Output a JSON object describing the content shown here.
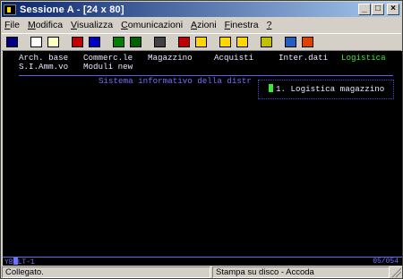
{
  "window": {
    "title": "Sessione A - [24 x 80]"
  },
  "menu": [
    {
      "mnemonic": "F",
      "rest": "ile"
    },
    {
      "mnemonic": "M",
      "rest": "odifica"
    },
    {
      "mnemonic": "V",
      "rest": "isualizza"
    },
    {
      "mnemonic": "C",
      "rest": "omunicazioni"
    },
    {
      "mnemonic": "A",
      "rest": "zioni"
    },
    {
      "mnemonic": "F",
      "rest": "inestra"
    },
    {
      "mnemonic": "?",
      "rest": ""
    }
  ],
  "toolbar": [
    {
      "icon": "print-screen-icon",
      "color": "#000080"
    },
    {
      "icon": "copy-icon",
      "color": "#ffffff"
    },
    {
      "icon": "paste-icon",
      "color": "#ffffc0"
    },
    {
      "icon": "send-file-icon",
      "color": "#c00000"
    },
    {
      "icon": "receive-file-icon",
      "color": "#0000c0"
    },
    {
      "icon": "display-icon",
      "color": "#008000"
    },
    {
      "icon": "display-session-icon",
      "color": "#006000"
    },
    {
      "icon": "record-macro-icon",
      "color": "#404040"
    },
    {
      "icon": "play-macro-icon",
      "color": "#c00000"
    },
    {
      "icon": "stop-macro-icon",
      "color": "#ffd700"
    },
    {
      "icon": "macro-run-icon",
      "color": "#ffd700"
    },
    {
      "icon": "keyboard-map-icon",
      "color": "#ffd700"
    },
    {
      "icon": "clipboard-icon",
      "color": "#c0c000"
    },
    {
      "icon": "globe-icon",
      "color": "#2060c0"
    },
    {
      "icon": "help-icon",
      "color": "#e04000"
    }
  ],
  "terminal": {
    "menu_row1": [
      "Arch. base",
      "Commerc.le",
      "Magazzino",
      "Acquisti",
      "Inter.dati",
      "Logistica"
    ],
    "menu_row2": [
      "S.I.Amm.vo",
      "Moduli new"
    ],
    "active_option": "Logistica",
    "sysinfo": "Sistema informativo della distr",
    "popup_item": "1. Logistica magazzino",
    "oia_prefix": "YB",
    "oia_suffix": "LT-1",
    "cursor_pos": "05/054"
  },
  "statusbar": {
    "left": "Collegato.",
    "right": "Stampa su disco - Accoda"
  }
}
